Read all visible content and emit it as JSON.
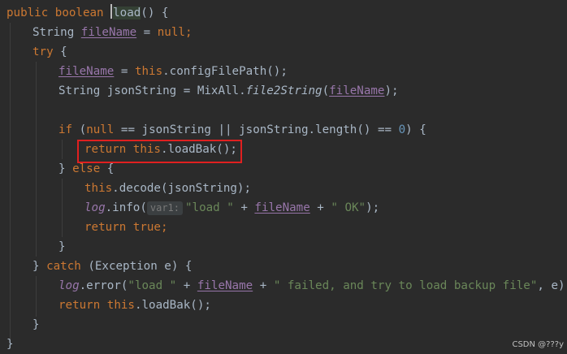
{
  "code": {
    "l1_kw": "public boolean ",
    "l1_method": "load",
    "l1_rest": "() {",
    "l2_type": "String ",
    "l2_var": "fileName",
    "l2_eq": " = ",
    "l2_null": "null",
    "l2_end": ";",
    "l3_try": "try",
    "l3_brace": " {",
    "l4_var": "fileName",
    "l4_eq": " = ",
    "l4_this": "this",
    "l4_call": ".configFilePath();",
    "l5_decl": "String jsonString = MixAll.",
    "l5_method": "file2String",
    "l5_paren": "(",
    "l5_arg": "fileName",
    "l5_end": ");",
    "l7_if": "if",
    "l7_open": " (",
    "l7_null": "null",
    "l7_mid": " == jsonString || jsonString.length() == ",
    "l7_zero": "0",
    "l7_end": ") {",
    "l8_return": "return ",
    "l8_this": "this",
    "l8_call": ".loadBak();",
    "l9_close": "} ",
    "l9_else": "else",
    "l9_brace": " {",
    "l10_this": "this",
    "l10_call": ".decode(jsonString);",
    "l11_log": "log",
    "l11_call": ".info(",
    "l11_hint": "var1:",
    "l11_str1": "\"load \"",
    "l11_plus1": " + ",
    "l11_var": "fileName",
    "l11_plus2": " + ",
    "l11_str2": "\" OK\"",
    "l11_end": ");",
    "l12_return": "return ",
    "l12_true": "true",
    "l12_end": ";",
    "l13_close": "}",
    "l14_close": "} ",
    "l14_catch": "catch",
    "l14_rest": " (Exception e) {",
    "l15_log": "log",
    "l15_call": ".error(",
    "l15_str1": "\"load \"",
    "l15_plus1": " + ",
    "l15_var": "fileName",
    "l15_plus2": " + ",
    "l15_str2": "\" failed, and try to load backup file\"",
    "l15_end": ", e);",
    "l16_return": "return ",
    "l16_this": "this",
    "l16_call": ".loadBak();",
    "l17_close": "}",
    "l18_close": "}"
  },
  "watermark": "CSDN @???y",
  "colors": {
    "background": "#2b2b2b",
    "keyword": "#cc7832",
    "string": "#6a8759",
    "number": "#6897bb",
    "field": "#9876aa",
    "default": "#a9b7c6",
    "highlight_box": "#e02020"
  }
}
